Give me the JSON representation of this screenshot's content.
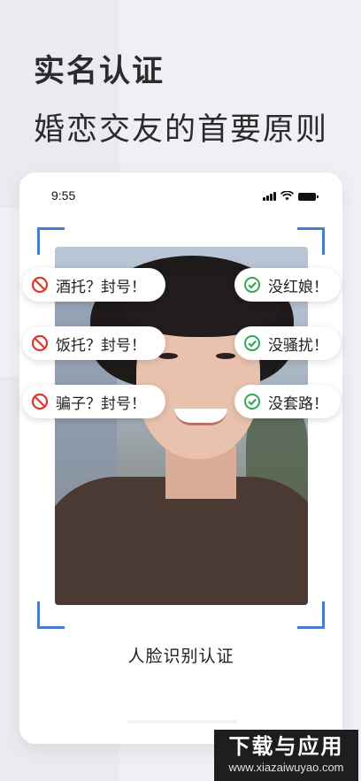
{
  "headline": "实名认证",
  "subline": "婚恋交友的首要原则",
  "status_bar": {
    "time": "9:55"
  },
  "tags_left": [
    {
      "label": "酒托？封号！",
      "icon": "prohibited-icon",
      "color": "#d9382f"
    },
    {
      "label": "饭托？封号！",
      "icon": "prohibited-icon",
      "color": "#d9382f"
    },
    {
      "label": "骗子？封号！",
      "icon": "prohibited-icon",
      "color": "#d9382f"
    }
  ],
  "tags_right": [
    {
      "label": "没红娘！",
      "icon": "check-circle-icon",
      "color": "#2fa84f"
    },
    {
      "label": "没骚扰！",
      "icon": "check-circle-icon",
      "color": "#2fa84f"
    },
    {
      "label": "没套路！",
      "icon": "check-circle-icon",
      "color": "#2fa84f"
    }
  ],
  "caption": "人脸识别认证",
  "watermark": {
    "main": "下载与应用",
    "url": "www.xiazaiwuyao.com"
  },
  "accent_color": "#4a7ccf"
}
